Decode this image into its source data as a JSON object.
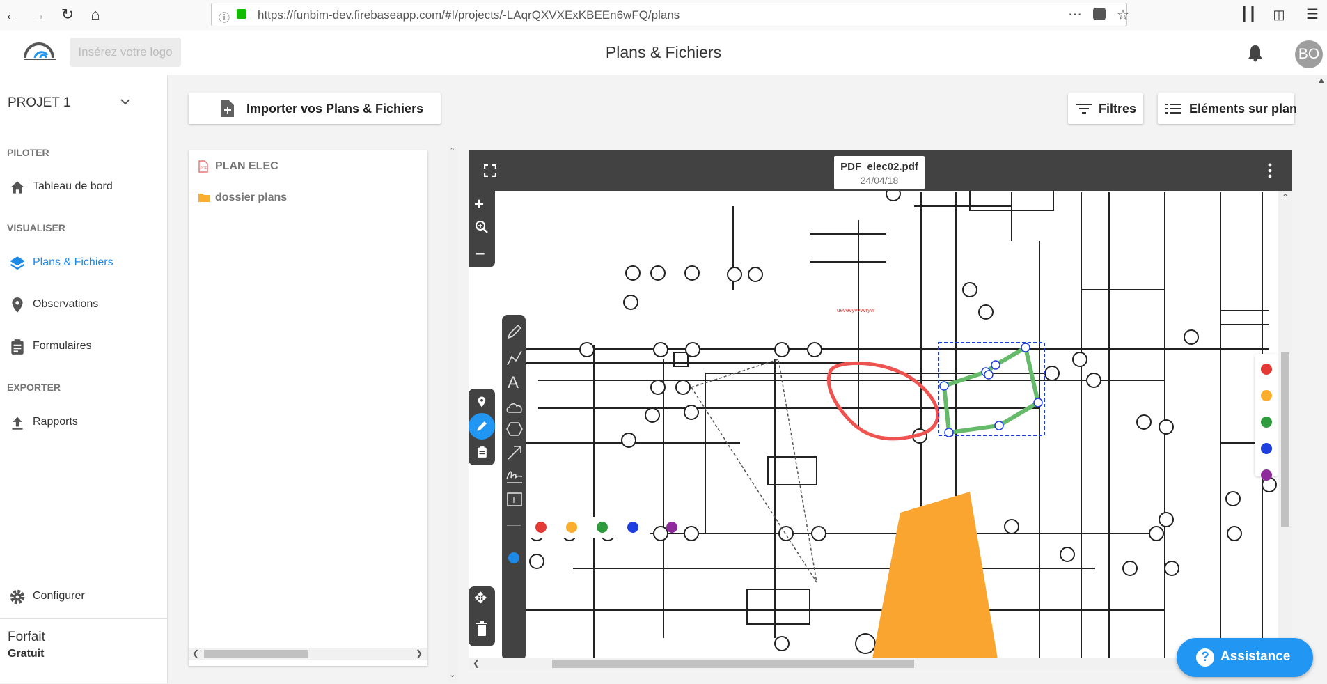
{
  "browser": {
    "url": "https://funbim-dev.firebaseapp.com/#!/projects/-LAqrQXVXExKBEEn6wFQ/plans"
  },
  "header": {
    "logo_placeholder": "Insérez votre logo",
    "title": "Plans & Fichiers",
    "avatar_initials": "BO"
  },
  "sidebar": {
    "project": "PROJET 1",
    "sections": {
      "piloter": "PILOTER",
      "visualiser": "VISUALISER",
      "exporter": "EXPORTER"
    },
    "items": {
      "dashboard": "Tableau de bord",
      "plans": "Plans & Fichiers",
      "observations": "Observations",
      "forms": "Formulaires",
      "reports": "Rapports",
      "configure": "Configurer"
    },
    "plan_label": "Forfait",
    "plan_value": "Gratuit"
  },
  "toolbar": {
    "import_label": "Importer vos Plans & Fichiers",
    "filters_label": "Filtres",
    "elements_label": "Eléments sur plan"
  },
  "files": {
    "items": [
      {
        "name": "PLAN ELEC",
        "icon": "pdf-file-icon"
      },
      {
        "name": "dossier plans",
        "icon": "folder-icon"
      }
    ]
  },
  "viewer": {
    "file_name": "PDF_elec02.pdf",
    "file_date": "24/04/18",
    "colors": [
      "#e53935",
      "#fbae2d",
      "#2e9b3d",
      "#1d3fe0",
      "#8e2a9c"
    ],
    "drawing_tools": [
      "pencil-icon",
      "polyline-icon",
      "text-icon",
      "cloud-icon",
      "polygon-icon",
      "arrow-icon",
      "signature-icon",
      "textbox-icon"
    ]
  },
  "assistance": {
    "label": "Assistance"
  }
}
